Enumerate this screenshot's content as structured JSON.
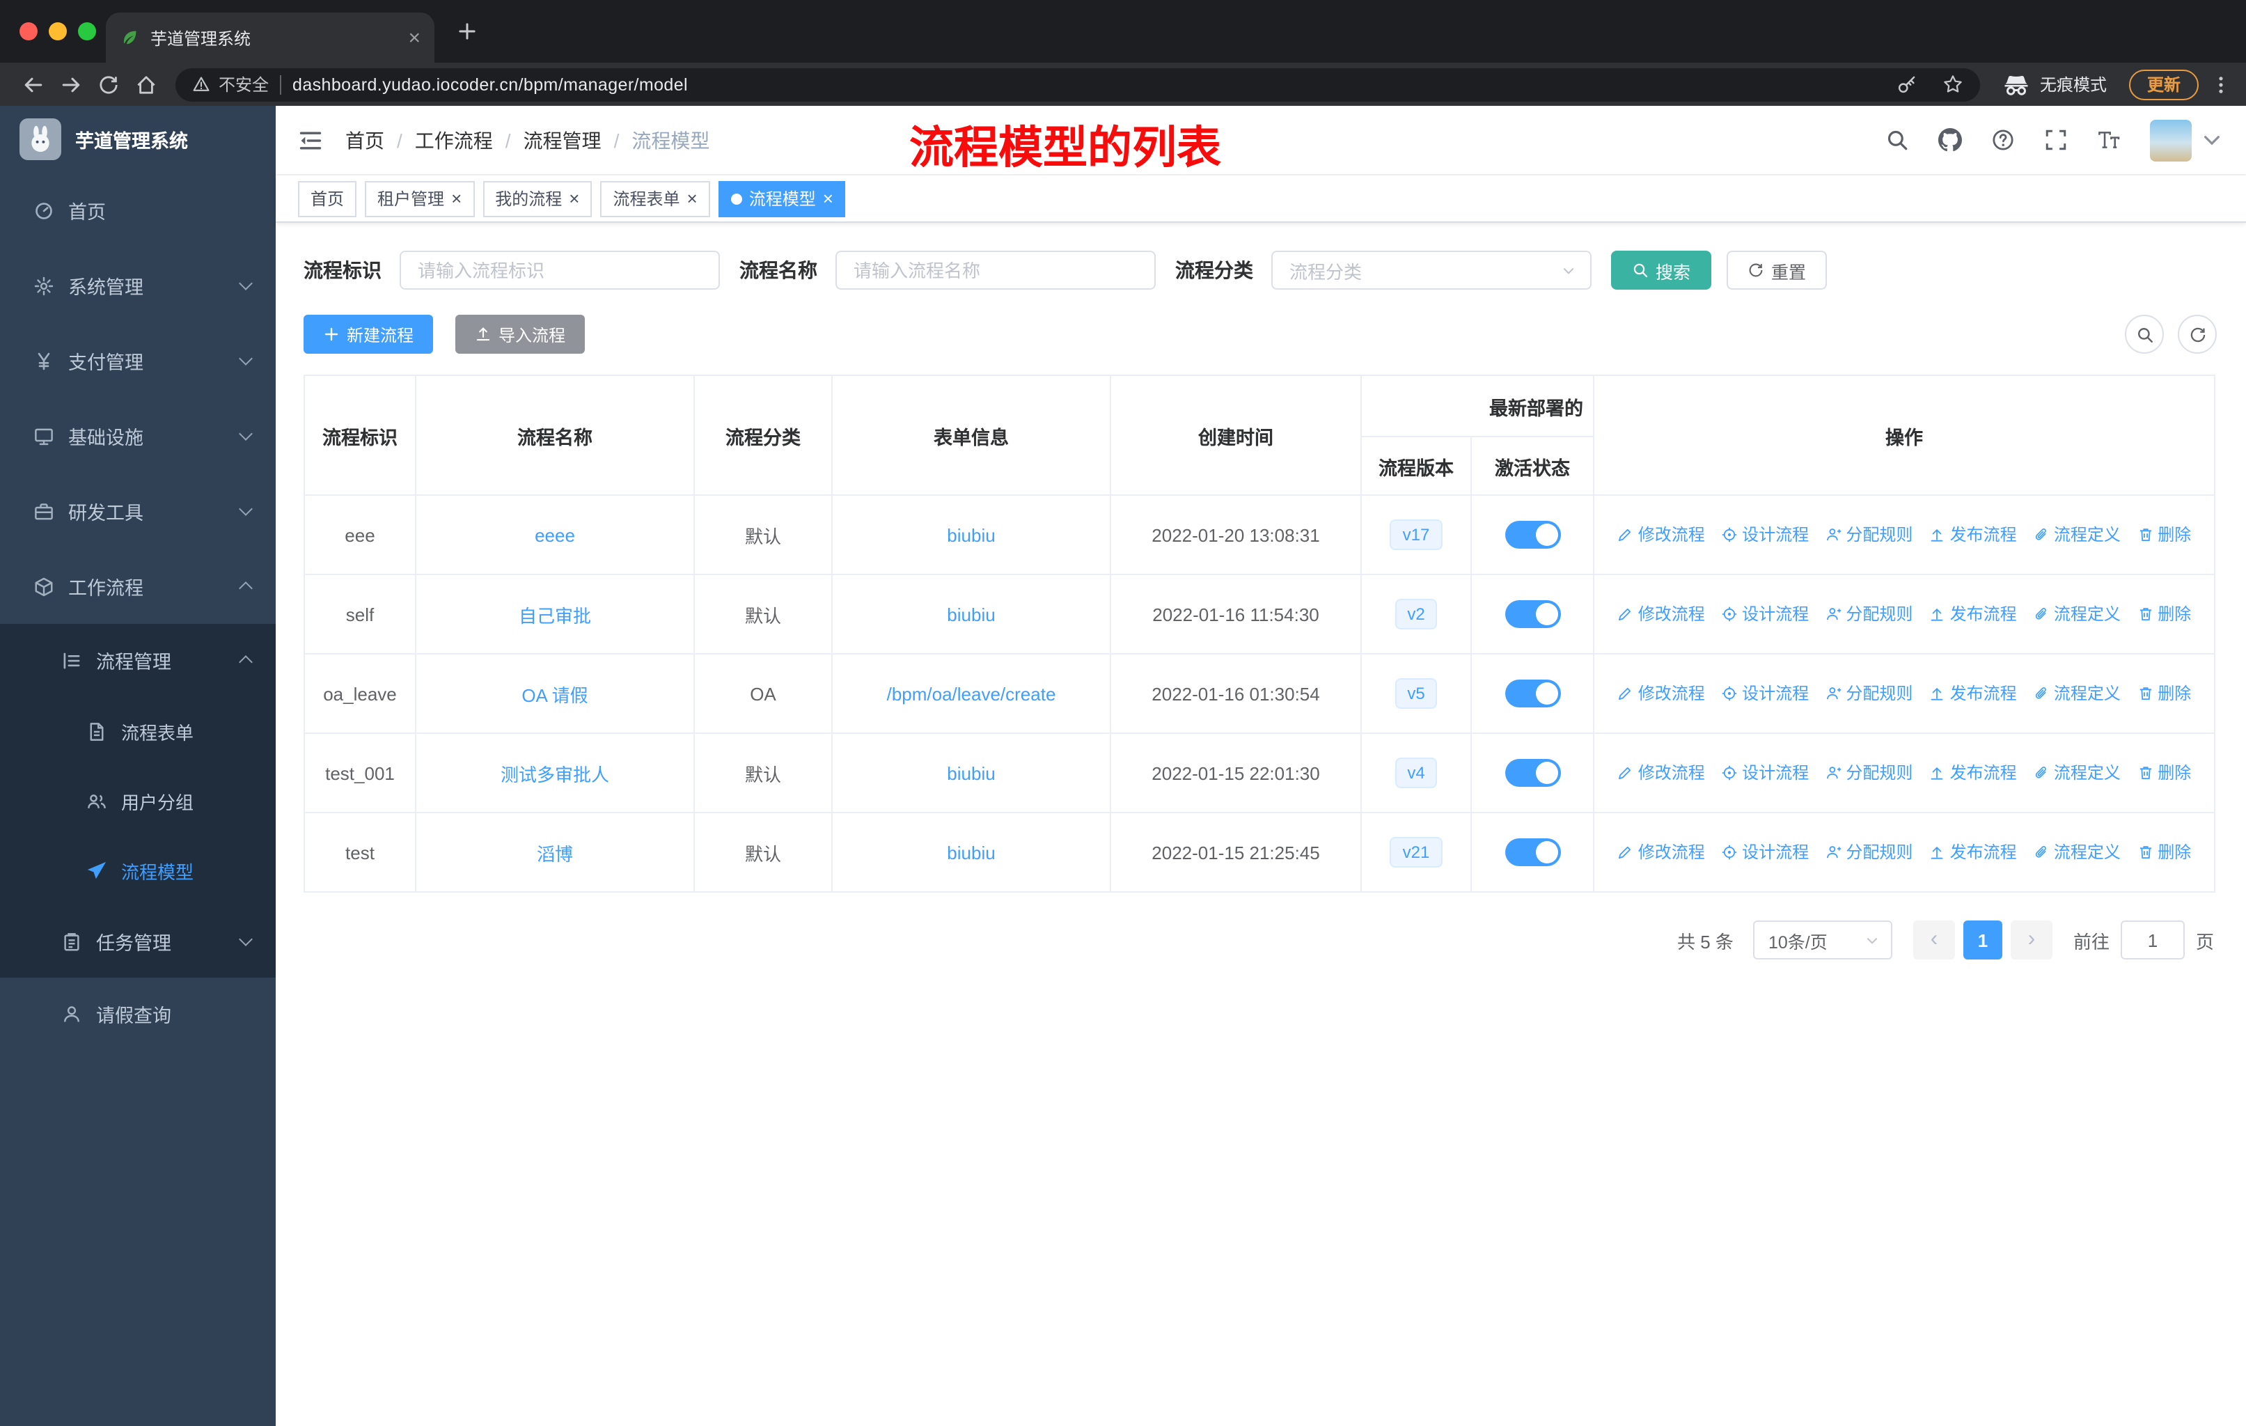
{
  "colors": {
    "primary": "#409eff",
    "link": "#409eff",
    "search-btn": "#3ab3a2",
    "import-btn": "#909399",
    "annotation": "#f70b0b",
    "sidebar-bg": "#304156",
    "submenu-bg": "#1f2d3d",
    "update-accent": "#e89b41"
  },
  "browser": {
    "tab_title": "芋道管理系统",
    "security_label": "不安全",
    "url": "dashboard.yudao.iocoder.cn/bpm/manager/model",
    "incognito_label": "无痕模式",
    "update_label": "更新"
  },
  "sidebar": {
    "logo_title": "芋道管理系统",
    "top": [
      {
        "label": "首页",
        "icon": "dashboard-icon"
      },
      {
        "label": "系统管理",
        "icon": "gear-icon",
        "arrow": true
      },
      {
        "label": "支付管理",
        "icon": "yen-icon",
        "arrow": true
      },
      {
        "label": "基础设施",
        "icon": "monitor-icon",
        "arrow": true
      },
      {
        "label": "研发工具",
        "icon": "toolbox-icon",
        "arrow": true
      },
      {
        "label": "工作流程",
        "icon": "cube-icon",
        "arrow": true,
        "arrow_up": true
      }
    ],
    "process_manage": {
      "label": "流程管理",
      "icon": "list-icon"
    },
    "process_children": [
      {
        "label": "流程表单",
        "icon": "document-icon"
      },
      {
        "label": "用户分组",
        "icon": "users-icon"
      },
      {
        "label": "流程模型",
        "icon": "plane-icon",
        "active": true
      }
    ],
    "task_manage": {
      "label": "任务管理",
      "icon": "task-icon"
    },
    "leave_query": {
      "label": "请假查询",
      "icon": "user-icon"
    }
  },
  "header": {
    "breadcrumb": [
      {
        "label": "首页"
      },
      {
        "label": "工作流程"
      },
      {
        "label": "流程管理"
      },
      {
        "label": "流程模型",
        "current": true
      }
    ],
    "annotation": "流程模型的列表"
  },
  "tags": [
    {
      "label": "首页"
    },
    {
      "label": "租户管理",
      "closable": true
    },
    {
      "label": "我的流程",
      "closable": true
    },
    {
      "label": "流程表单",
      "closable": true
    },
    {
      "label": "流程模型",
      "closable": true,
      "active": true
    }
  ],
  "filters": {
    "key_label": "流程标识",
    "key_placeholder": "请输入流程标识",
    "name_label": "流程名称",
    "name_placeholder": "请输入流程名称",
    "category_label": "流程分类",
    "category_placeholder": "流程分类",
    "search_label": "搜索",
    "reset_label": "重置"
  },
  "toolbar": {
    "create_label": "新建流程",
    "import_label": "导入流程"
  },
  "table": {
    "headers": {
      "key": "流程标识",
      "name": "流程名称",
      "category": "流程分类",
      "form": "表单信息",
      "created": "创建时间",
      "deploy_group": "最新部署的",
      "version": "流程版本",
      "status": "激活状态",
      "actions": "操作"
    },
    "actions": [
      {
        "label": "修改流程",
        "icon": "edit-icon"
      },
      {
        "label": "设计流程",
        "icon": "design-icon"
      },
      {
        "label": "分配规则",
        "icon": "assign-icon"
      },
      {
        "label": "发布流程",
        "icon": "publish-icon"
      },
      {
        "label": "流程定义",
        "icon": "definition-icon"
      },
      {
        "label": "删除",
        "icon": "delete-icon"
      }
    ],
    "rows": [
      {
        "key": "eee",
        "name": "eeee",
        "category": "默认",
        "form": "biubiu",
        "created": "2022-01-20 13:08:31",
        "version": "v17",
        "active": true
      },
      {
        "key": "self",
        "name": "自己审批",
        "category": "默认",
        "form": "biubiu",
        "created": "2022-01-16 11:54:30",
        "version": "v2",
        "active": true
      },
      {
        "key": "oa_leave",
        "name": "OA 请假",
        "category": "OA",
        "form": "/bpm/oa/leave/create",
        "created": "2022-01-16 01:30:54",
        "version": "v5",
        "active": true
      },
      {
        "key": "test_001",
        "name": "测试多审批人",
        "category": "默认",
        "form": "biubiu",
        "created": "2022-01-15 22:01:30",
        "version": "v4",
        "active": true
      },
      {
        "key": "test",
        "name": "滔博",
        "category": "默认",
        "form": "biubiu",
        "created": "2022-01-15 21:25:45",
        "version": "v21",
        "active": true
      }
    ]
  },
  "pagination": {
    "total": "共 5 条",
    "page_size": "10条/页",
    "prev": "‹",
    "page": "1",
    "next": "›",
    "goto_label": "前往",
    "goto_value": "1",
    "unit": "页"
  }
}
